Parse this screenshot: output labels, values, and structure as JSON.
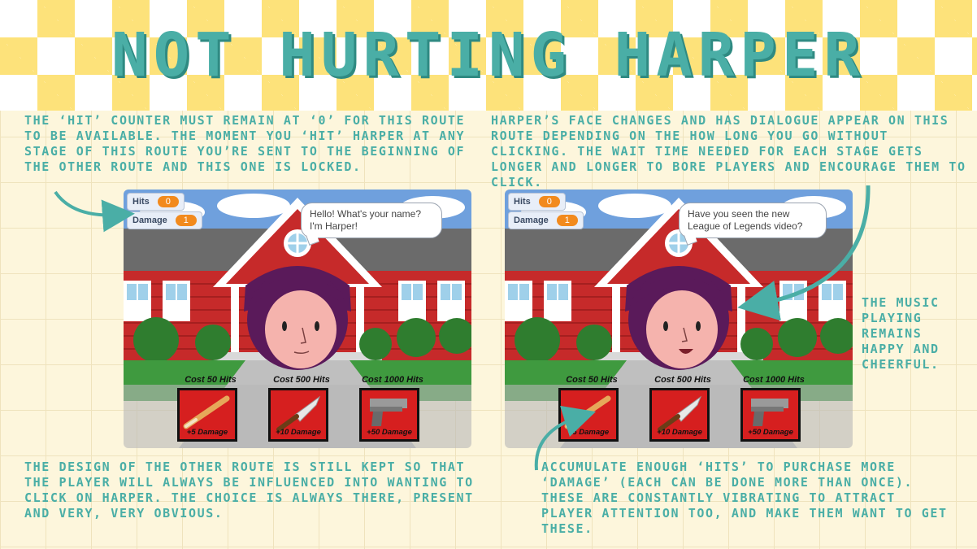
{
  "page": {
    "title": "NOT HURTING HARPER",
    "colors": {
      "accent": "#4aaea6",
      "checker": "#fde27a",
      "background": "#fdf6dc"
    }
  },
  "notes": {
    "top_left": "THE ‘HIT’ COUNTER MUST REMAIN AT ‘0’ FOR THIS ROUTE TO BE AVAILABLE. THE MOMENT YOU ‘HIT’ HARPER AT ANY STAGE OF THIS ROUTE YOU’RE SENT TO THE BEGINNING OF THE OTHER ROUTE AND THIS ONE IS LOCKED.",
    "top_right": "HARPER’S FACE CHANGES AND HAS DIALOGUE APPEAR ON THIS ROUTE DEPENDING ON THE HOW LONG YOU GO WITHOUT CLICKING. THE WAIT TIME NEEDED FOR EACH STAGE GETS LONGER AND LONGER TO BORE PLAYERS AND ENCOURAGE THEM TO CLICK.",
    "side_right": "THE MUSIC PLAYING REMAINS HAPPY AND CHEERFUL.",
    "bottom_left": "THE DESIGN OF THE OTHER ROUTE IS STILL KEPT SO THAT THE PLAYER WILL ALWAYS BE INFLUENCED INTO WANTING TO CLICK ON HARPER. THE CHOICE IS ALWAYS THERE, PRESENT AND VERY, VERY OBVIOUS.",
    "bottom_right": "ACCUMULATE ENOUGH ‘HITS’ TO PURCHASE MORE ‘DAMAGE’ (EACH CAN BE DONE MORE THAN ONCE). THESE ARE CONSTANTLY VIBRATING TO ATTRACT PLAYER ATTENTION TOO, AND MAKE THEM WANT TO GET THESE."
  },
  "screens": [
    {
      "hits_label": "Hits",
      "hits_value": "0",
      "damage_label": "Damage",
      "damage_value": "1",
      "dialogue": "Hello! What's your name? I'm Harper!",
      "shop": [
        {
          "cost": "Cost 50 Hits",
          "damage": "+5 Damage",
          "icon": "baseball-bat-icon"
        },
        {
          "cost": "Cost 500 Hits",
          "damage": "+10 Damage",
          "icon": "knife-icon"
        },
        {
          "cost": "Cost 1000 Hits",
          "damage": "+50 Damage",
          "icon": "gun-icon"
        }
      ]
    },
    {
      "hits_label": "Hits",
      "hits_value": "0",
      "damage_label": "Damage",
      "damage_value": "1",
      "dialogue": "Have you seen the new League of Legends video?",
      "shop": [
        {
          "cost": "Cost 50 Hits",
          "damage": "+5 Damage",
          "icon": "baseball-bat-icon"
        },
        {
          "cost": "Cost 500 Hits",
          "damage": "+10 Damage",
          "icon": "knife-icon"
        },
        {
          "cost": "Cost 1000 Hits",
          "damage": "+50 Damage",
          "icon": "gun-icon"
        }
      ]
    }
  ]
}
